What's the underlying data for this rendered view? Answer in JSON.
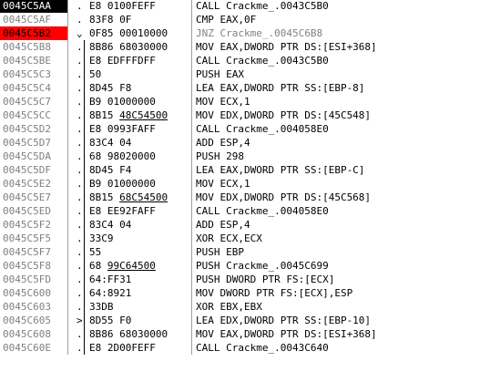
{
  "disassembly": {
    "rows": [
      {
        "address": "0045C5AA",
        "marker": ".",
        "hex": "E8 0100FEFF",
        "reloc": "",
        "reloc_tail": "",
        "asm": "CALL Crackme_.0043C5B0",
        "addr_style": "eip"
      },
      {
        "address": "0045C5AF",
        "marker": ".",
        "hex": "83F8 0F",
        "reloc": "",
        "reloc_tail": "",
        "asm": "CMP EAX,0F",
        "addr_style": ""
      },
      {
        "address": "0045C5B2",
        "marker": "⌄",
        "hex": "0F85 00010000",
        "reloc": "",
        "reloc_tail": "",
        "asm": "JNZ Crackme_.0045C6B8",
        "addr_style": "bp",
        "muted": true
      },
      {
        "address": "0045C5B8",
        "marker": ".",
        "hex": "8B86 68030000",
        "reloc": "",
        "reloc_tail": "",
        "asm": "MOV EAX,DWORD PTR DS:[ESI+368]",
        "addr_style": ""
      },
      {
        "address": "0045C5BE",
        "marker": ".",
        "hex": "E8 EDFFFDFF",
        "reloc": "",
        "reloc_tail": "",
        "asm": "CALL Crackme_.0043C5B0",
        "addr_style": ""
      },
      {
        "address": "0045C5C3",
        "marker": ".",
        "hex": "50",
        "reloc": "",
        "reloc_tail": "",
        "asm": "PUSH EAX",
        "addr_style": ""
      },
      {
        "address": "0045C5C4",
        "marker": ".",
        "hex": "8D45 F8",
        "reloc": "",
        "reloc_tail": "",
        "asm": "LEA EAX,DWORD PTR SS:[EBP-8]",
        "addr_style": ""
      },
      {
        "address": "0045C5C7",
        "marker": ".",
        "hex": "B9 01000000",
        "reloc": "",
        "reloc_tail": "",
        "asm": "MOV ECX,1",
        "addr_style": ""
      },
      {
        "address": "0045C5CC",
        "marker": ".",
        "hex": "8B15 ",
        "reloc": "48C54500",
        "reloc_tail": "",
        "asm": "MOV EDX,DWORD PTR DS:[45C548]",
        "addr_style": ""
      },
      {
        "address": "0045C5D2",
        "marker": ".",
        "hex": "E8 0993FAFF",
        "reloc": "",
        "reloc_tail": "",
        "asm": "CALL Crackme_.004058E0",
        "addr_style": ""
      },
      {
        "address": "0045C5D7",
        "marker": ".",
        "hex": "83C4 04",
        "reloc": "",
        "reloc_tail": "",
        "asm": "ADD ESP,4",
        "addr_style": ""
      },
      {
        "address": "0045C5DA",
        "marker": ".",
        "hex": "68 98020000",
        "reloc": "",
        "reloc_tail": "",
        "asm": "PUSH 298",
        "addr_style": ""
      },
      {
        "address": "0045C5DF",
        "marker": ".",
        "hex": "8D45 F4",
        "reloc": "",
        "reloc_tail": "",
        "asm": "LEA EAX,DWORD PTR SS:[EBP-C]",
        "addr_style": ""
      },
      {
        "address": "0045C5E2",
        "marker": ".",
        "hex": "B9 01000000",
        "reloc": "",
        "reloc_tail": "",
        "asm": "MOV ECX,1",
        "addr_style": ""
      },
      {
        "address": "0045C5E7",
        "marker": ".",
        "hex": "8B15 ",
        "reloc": "68C54500",
        "reloc_tail": "",
        "asm": "MOV EDX,DWORD PTR DS:[45C568]",
        "addr_style": ""
      },
      {
        "address": "0045C5ED",
        "marker": ".",
        "hex": "E8 EE92FAFF",
        "reloc": "",
        "reloc_tail": "",
        "asm": "CALL Crackme_.004058E0",
        "addr_style": ""
      },
      {
        "address": "0045C5F2",
        "marker": ".",
        "hex": "83C4 04",
        "reloc": "",
        "reloc_tail": "",
        "asm": "ADD ESP,4",
        "addr_style": ""
      },
      {
        "address": "0045C5F5",
        "marker": ".",
        "hex": "33C9",
        "reloc": "",
        "reloc_tail": "",
        "asm": "XOR ECX,ECX",
        "addr_style": ""
      },
      {
        "address": "0045C5F7",
        "marker": ".",
        "hex": "55",
        "reloc": "",
        "reloc_tail": "",
        "asm": "PUSH EBP",
        "addr_style": ""
      },
      {
        "address": "0045C5F8",
        "marker": ".",
        "hex": "68 ",
        "reloc": "99C64500",
        "reloc_tail": "",
        "asm": "PUSH Crackme_.0045C699",
        "addr_style": ""
      },
      {
        "address": "0045C5FD",
        "marker": ".",
        "hex": "64:FF31",
        "reloc": "",
        "reloc_tail": "",
        "asm": "PUSH DWORD PTR FS:[ECX]",
        "addr_style": ""
      },
      {
        "address": "0045C600",
        "marker": ".",
        "hex": "64:8921",
        "reloc": "",
        "reloc_tail": "",
        "asm": "MOV DWORD PTR FS:[ECX],ESP",
        "addr_style": ""
      },
      {
        "address": "0045C603",
        "marker": ".",
        "hex": "33DB",
        "reloc": "",
        "reloc_tail": "",
        "asm": "XOR EBX,EBX",
        "addr_style": ""
      },
      {
        "address": "0045C605",
        "marker": ">",
        "hex": "8D55 F0",
        "reloc": "",
        "reloc_tail": "",
        "asm": "LEA EDX,DWORD PTR SS:[EBP-10]",
        "addr_style": ""
      },
      {
        "address": "0045C608",
        "marker": ".",
        "hex": "8B86 68030000",
        "reloc": "",
        "reloc_tail": "",
        "asm": "MOV EAX,DWORD PTR DS:[ESI+368]",
        "addr_style": ""
      },
      {
        "address": "0045C60E",
        "marker": ".",
        "hex": "E8 2D00FEFF",
        "reloc": "",
        "reloc_tail": "",
        "asm": "CALL Crackme_.0043C640",
        "addr_style": ""
      }
    ]
  }
}
